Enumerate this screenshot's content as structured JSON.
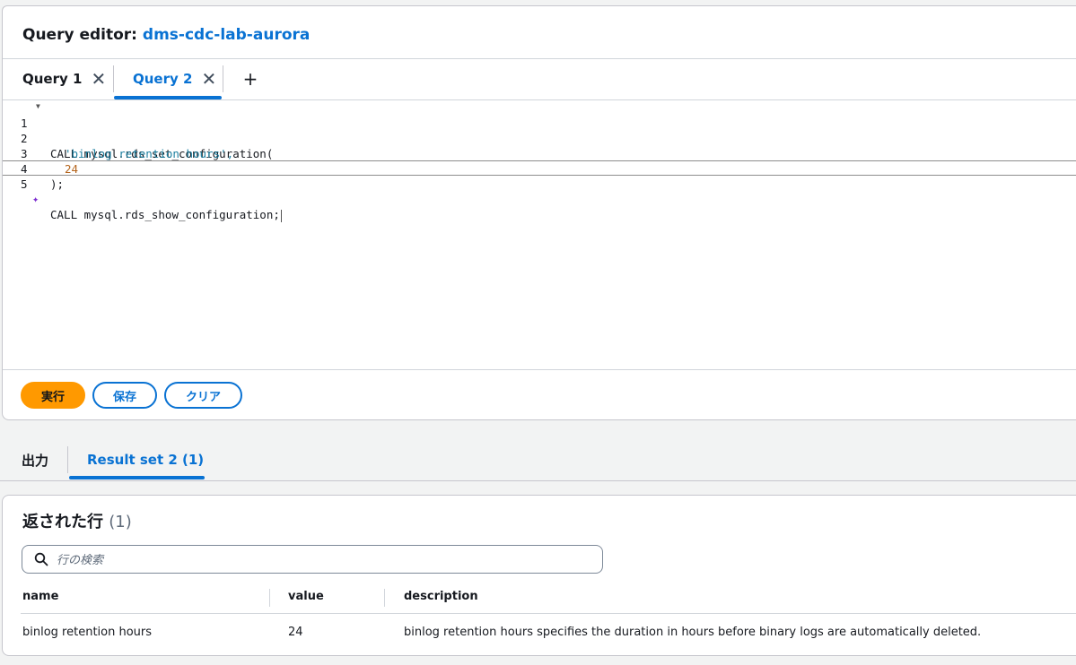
{
  "header": {
    "label": "Query editor:",
    "database": "dms-cdc-lab-aurora"
  },
  "tabs": [
    {
      "label": "Query 1",
      "active": false
    },
    {
      "label": "Query 2",
      "active": true
    }
  ],
  "add_tab_symbol": "+",
  "close_symbol": "✕",
  "editor": {
    "lines": [
      {
        "number": "1",
        "text": "CALL mysql.rds_set_configuration("
      },
      {
        "number": "2",
        "text": "'binlog retention hours',"
      },
      {
        "number": "3",
        "text": "24"
      },
      {
        "number": "4",
        "text": ");"
      },
      {
        "number": "5",
        "text": "CALL mysql.rds_show_configuration;"
      }
    ]
  },
  "actions": {
    "run": "実行",
    "save": "保存",
    "clear": "クリア"
  },
  "output_tabs": {
    "output": "出力",
    "result_set": "Result set 2 (1)"
  },
  "results": {
    "title": "返された行",
    "count": "(1)",
    "search_placeholder": "行の検索",
    "columns": [
      "name",
      "value",
      "description"
    ],
    "rows": [
      {
        "name": "binlog retention hours",
        "value": "24",
        "description": "binlog retention hours specifies the duration in hours before binary logs are automatically deleted."
      }
    ]
  },
  "colors": {
    "accent": "#0972d3",
    "primary_button": "#ff9900",
    "string": "#1c7fa0",
    "number": "#b5651d",
    "ai_icon": "#7d2fd0"
  }
}
